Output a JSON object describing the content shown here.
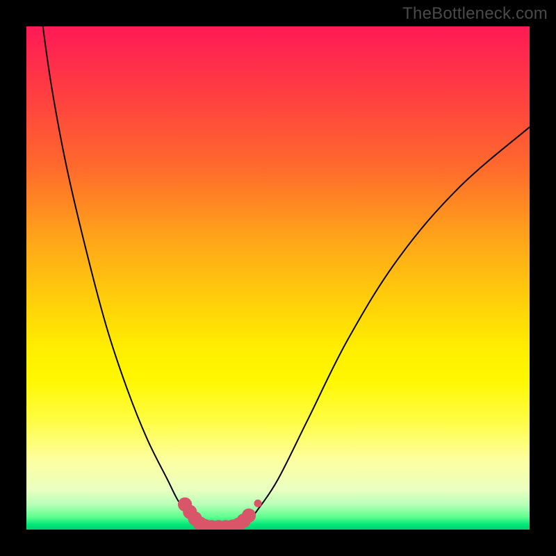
{
  "watermark": "TheBottleneck.com",
  "colors": {
    "curve_stroke": "#000000",
    "marker_fill": "#d9566a",
    "frame": "#000000"
  },
  "chart_data": {
    "type": "line",
    "title": "",
    "xlabel": "",
    "ylabel": "",
    "xlim": [
      0,
      100
    ],
    "ylim": [
      0,
      100
    ],
    "grid": false,
    "legend": false,
    "series": [
      {
        "name": "left-curve",
        "x": [
          3,
          5,
          8,
          12,
          16,
          20,
          24,
          28,
          30,
          32,
          33.5,
          34.5
        ],
        "y": [
          102,
          88,
          72,
          55,
          40,
          28,
          18,
          10,
          6,
          3,
          1.2,
          0.5
        ]
      },
      {
        "name": "right-curve",
        "x": [
          42.5,
          44,
          46,
          50,
          56,
          64,
          74,
          86,
          100
        ],
        "y": [
          0.5,
          1.5,
          4,
          10,
          22,
          38,
          54,
          68,
          80
        ]
      },
      {
        "name": "valley-floor",
        "x": [
          34.5,
          42.5
        ],
        "y": [
          0.5,
          0.5
        ]
      }
    ],
    "markers": [
      {
        "x": 31.5,
        "y": 5.0
      },
      {
        "x": 32.5,
        "y": 3.5
      },
      {
        "x": 33.5,
        "y": 2.2
      },
      {
        "x": 34.5,
        "y": 1.2
      },
      {
        "x": 35.5,
        "y": 0.7
      },
      {
        "x": 36.8,
        "y": 0.5
      },
      {
        "x": 38.2,
        "y": 0.5
      },
      {
        "x": 39.6,
        "y": 0.5
      },
      {
        "x": 41.0,
        "y": 0.6
      },
      {
        "x": 42.2,
        "y": 1.0
      },
      {
        "x": 43.2,
        "y": 1.8
      },
      {
        "x": 44.2,
        "y": 2.8
      },
      {
        "x": 46.0,
        "y": 5.2
      }
    ],
    "marker_radius": 1.4
  }
}
